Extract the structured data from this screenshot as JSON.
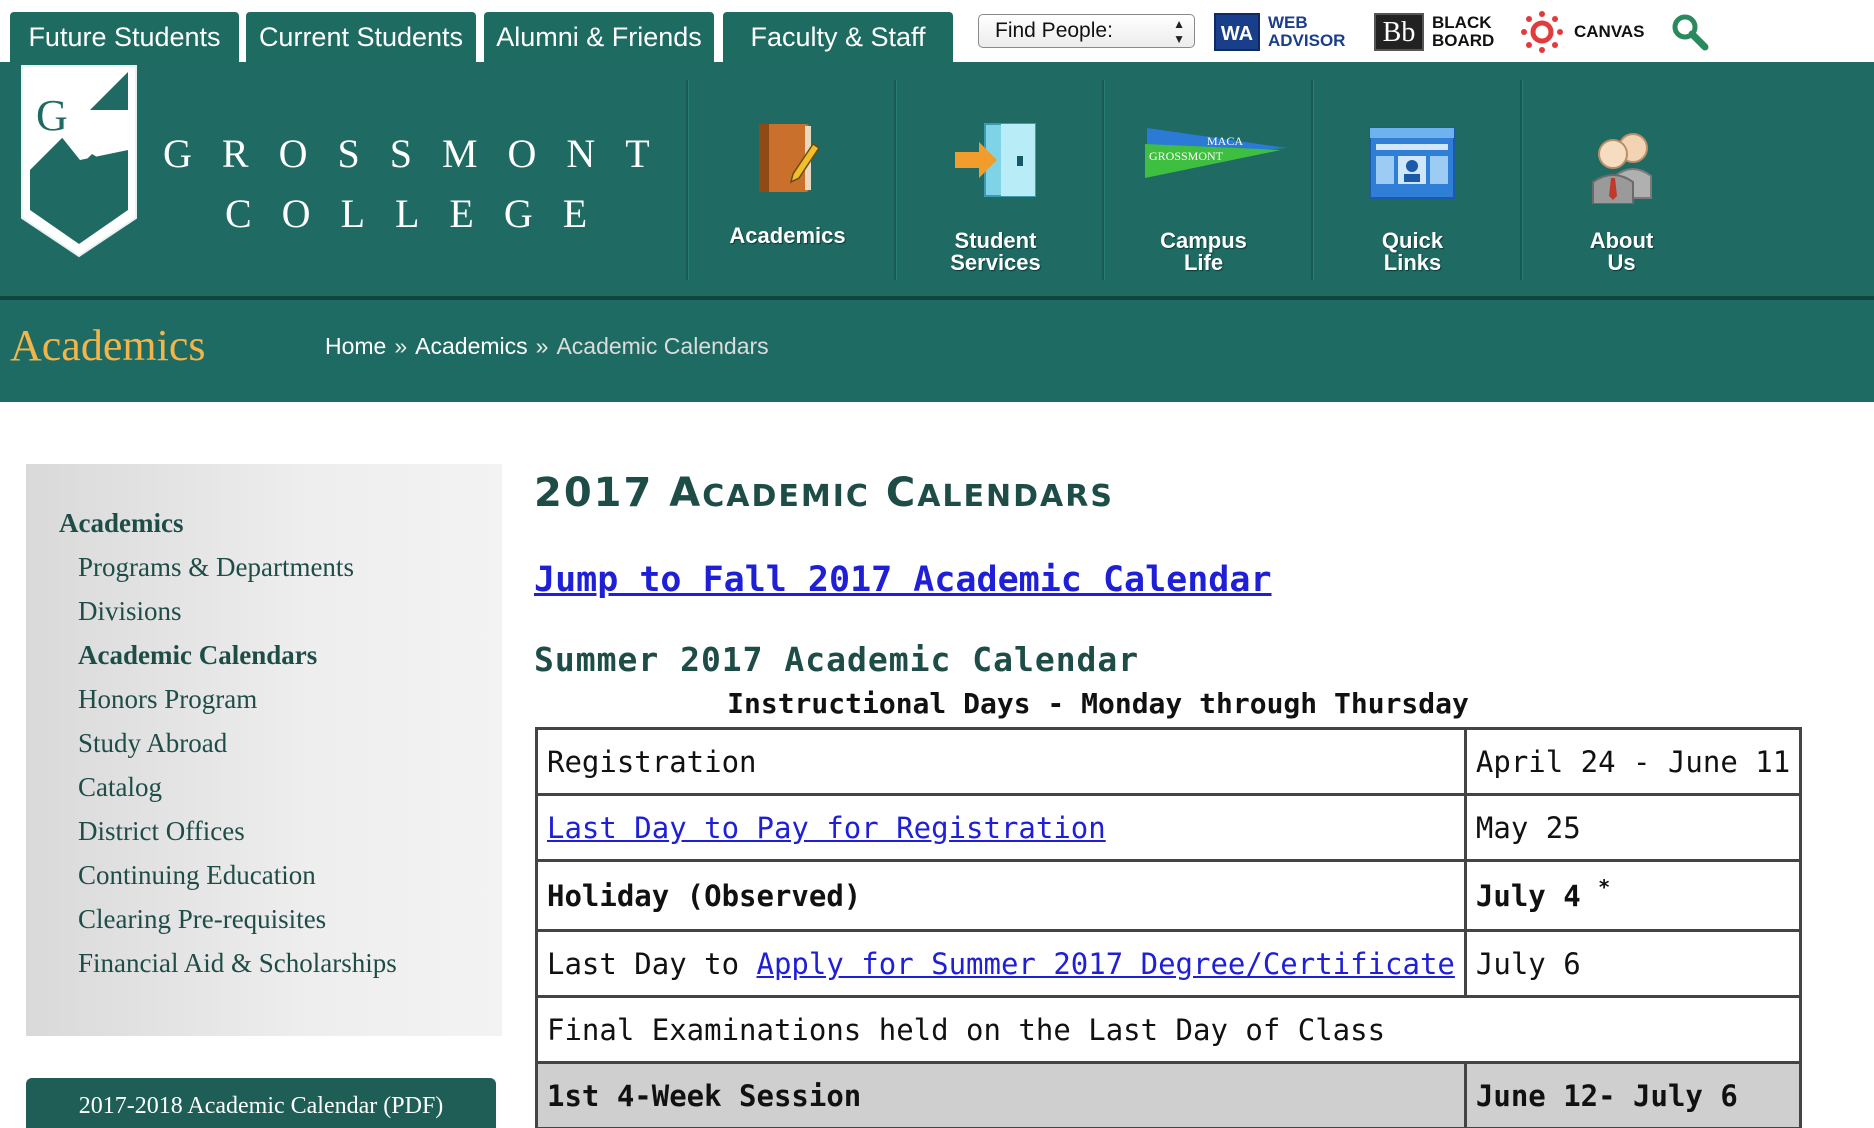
{
  "topbar": {
    "tabs": [
      "Future Students",
      "Current Students",
      "Alumni & Friends",
      "Faculty & Staff"
    ],
    "find_people": {
      "label": "Find People:",
      "arrows": "▲▼"
    },
    "links": {
      "webadvisor": {
        "badge": "WA",
        "line1": "WEB",
        "line2": "ADVISOR"
      },
      "blackboard": {
        "badge": "Bb",
        "line1": "BLACK",
        "line2": "BOARD"
      },
      "canvas": {
        "label": "CANVAS"
      }
    },
    "search_icon": "magnifier-icon",
    "colors": {
      "tab_bg": "#1e6b62",
      "webadvisor_text": "#1a3f8a",
      "canvas_red": "#e23b3b",
      "search_green": "#2a8a5e"
    }
  },
  "header": {
    "logo_letter": "G",
    "wordmark_line1": "GROSSMONT",
    "wordmark_line2": "COLLEGE",
    "nav": [
      {
        "line1": "Academics",
        "line2": "",
        "icon": "book-pencil-icon"
      },
      {
        "line1": "Student",
        "line2": "Services",
        "icon": "door-arrow-icon"
      },
      {
        "line1": "Campus",
        "line2": "Life",
        "icon": "pennant-icon"
      },
      {
        "line1": "Quick",
        "line2": "Links",
        "icon": "webpage-icon"
      },
      {
        "line1": "About",
        "line2": "Us",
        "icon": "people-icon"
      }
    ],
    "pennant_text_top": "MACA",
    "pennant_text": "GROSSMONT",
    "colors": {
      "band": "#1f6b63",
      "section_title": "#f3b54a"
    }
  },
  "section": {
    "title": "Academics",
    "breadcrumb": [
      "Home",
      "Academics",
      "Academic Calendars"
    ],
    "breadcrumb_sep": "»"
  },
  "sidebar": {
    "heading": "Academics",
    "items": [
      {
        "label": "Programs & Departments",
        "active": false
      },
      {
        "label": "Divisions",
        "active": false
      },
      {
        "label": "Academic Calendars",
        "active": true
      },
      {
        "label": "Honors Program",
        "active": false
      },
      {
        "label": "Study Abroad",
        "active": false
      },
      {
        "label": "Catalog",
        "active": false
      },
      {
        "label": "District Offices",
        "active": false
      },
      {
        "label": "Continuing Education",
        "active": false
      },
      {
        "label": "Clearing Pre-requisites",
        "active": false
      },
      {
        "label": "Financial Aid & Scholarships",
        "active": false
      }
    ],
    "pdf_button": "2017-2018 Academic Calendar (PDF)"
  },
  "main": {
    "title_year": "2017",
    "title_A": "A",
    "title_rest1": "CADEMIC",
    "title_C": "C",
    "title_rest2": "ALENDARS",
    "jump_link": "Jump to Fall 2017 Academic Calendar",
    "summer_heading": "Summer 2017 Academic Calendar",
    "subheading": "Instructional Days - Monday through Thursday",
    "rows": {
      "registration": {
        "label": "Registration",
        "date": "April 24 - June 11"
      },
      "last_pay": {
        "label": "Last Day to Pay for Registration",
        "date": "May 25"
      },
      "holiday": {
        "label": "Holiday (Observed)",
        "date": "July 4",
        "mark": "*"
      },
      "apply": {
        "prefix": "Last Day to ",
        "link": "Apply for Summer 2017 Degree/Certificate",
        "date": "July 6"
      },
      "finals": {
        "label": "Final Examinations held on the Last Day of Class"
      },
      "session1": {
        "label": "1st 4-Week Session",
        "date": "June 12- July 6"
      }
    }
  }
}
